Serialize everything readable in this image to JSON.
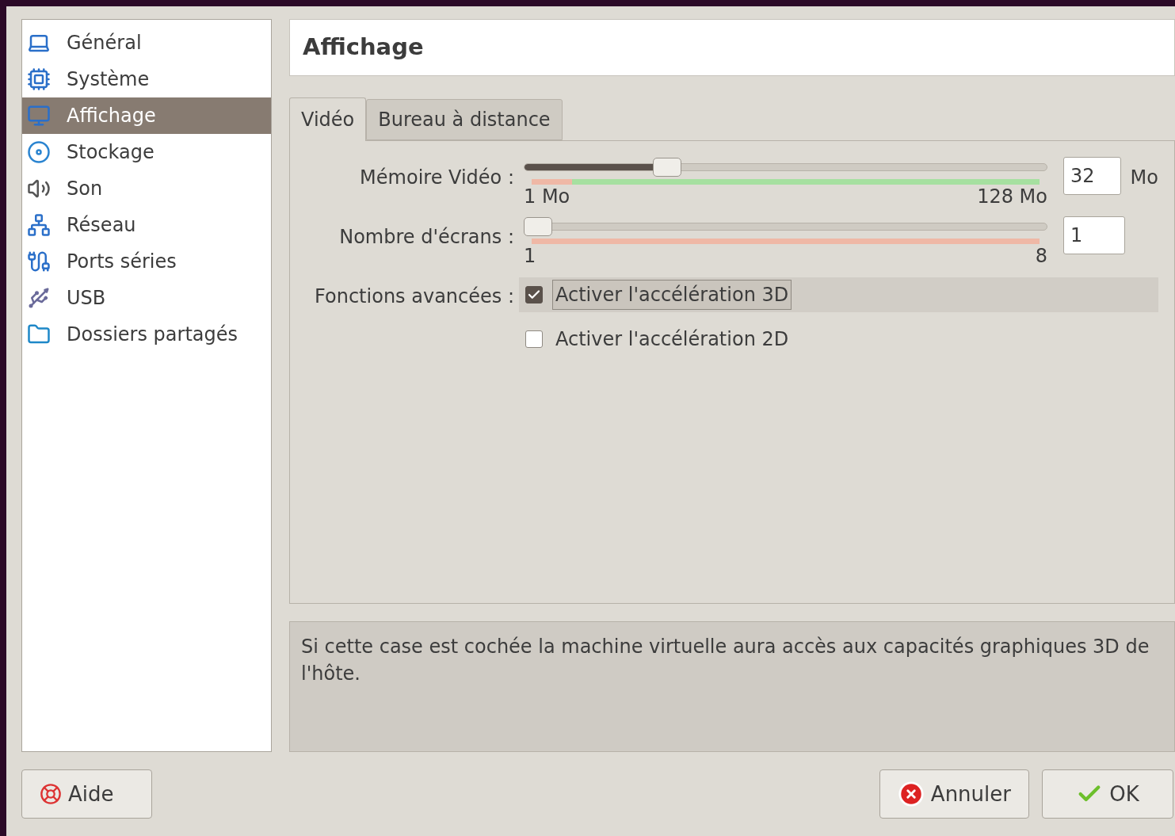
{
  "sidebar": {
    "items": [
      {
        "label": "Général",
        "selected": false
      },
      {
        "label": "Système",
        "selected": false
      },
      {
        "label": "Affichage",
        "selected": true
      },
      {
        "label": "Stockage",
        "selected": false
      },
      {
        "label": "Son",
        "selected": false
      },
      {
        "label": "Réseau",
        "selected": false
      },
      {
        "label": "Ports séries",
        "selected": false
      },
      {
        "label": "USB",
        "selected": false
      },
      {
        "label": "Dossiers partagés",
        "selected": false
      }
    ]
  },
  "page_title": "Affichage",
  "tabs": [
    {
      "label": "Vidéo",
      "selected": true
    },
    {
      "label": "Bureau à distance",
      "selected": false
    }
  ],
  "sliders": [
    {
      "label": "Mémoire Vidéo :",
      "level": 0.26,
      "min": "1 Mo",
      "max": "128 Mo",
      "value": "32",
      "unit": "Mo"
    },
    {
      "label": "Nombre d'écrans :",
      "level": 0,
      "min": "1",
      "max": "8",
      "value": "1"
    }
  ],
  "advanced": {
    "label": "Fonctions avancées :",
    "options": [
      {
        "label": "Activer l'accélération 3D",
        "checked": true,
        "focused": true
      },
      {
        "label": "Activer l'accélération 2D",
        "checked": false,
        "focused": false
      }
    ]
  },
  "description": "Si cette case est cochée la machine virtuelle aura accès aux capacités graphiques 3D de l'hôte.",
  "buttons": [
    {
      "label": "Aide",
      "kind": "help"
    },
    {
      "label": "Annuler",
      "kind": "cancel"
    },
    {
      "label": "OK",
      "kind": "ok"
    }
  ]
}
